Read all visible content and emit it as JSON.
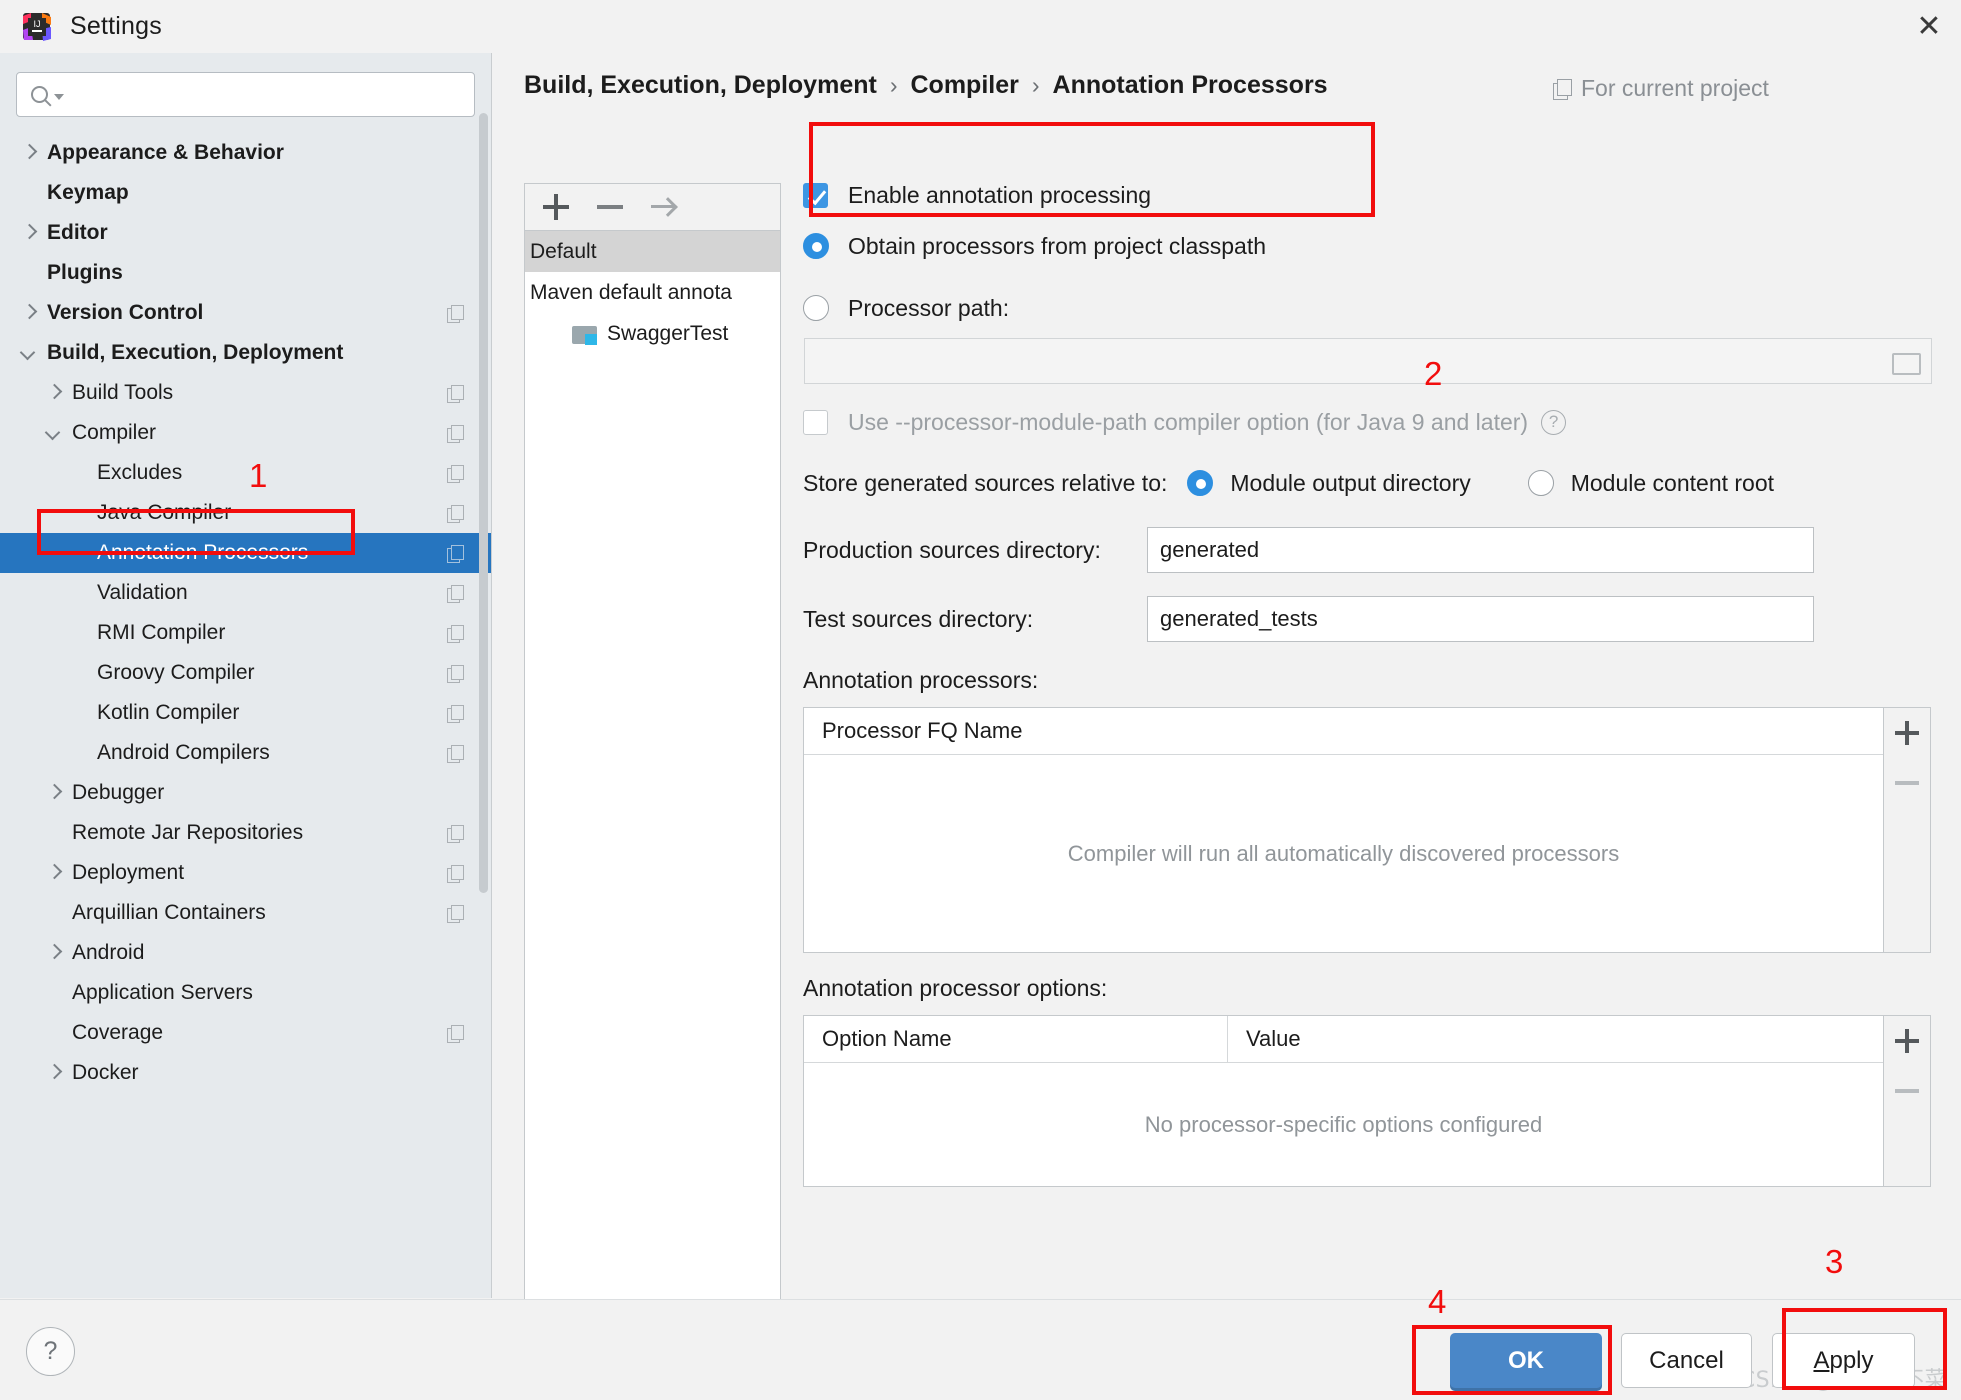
{
  "window": {
    "title": "Settings",
    "app_icon": "intellij-idea-logo",
    "close_label": "✕"
  },
  "search": {
    "value": "",
    "placeholder": ""
  },
  "sidebar": {
    "items": [
      {
        "label": "Appearance & Behavior",
        "indent": 0,
        "arrow": "right",
        "bold": true,
        "copy": false,
        "selected": false
      },
      {
        "label": "Keymap",
        "indent": 0,
        "arrow": "none",
        "bold": true,
        "copy": false,
        "selected": false
      },
      {
        "label": "Editor",
        "indent": 0,
        "arrow": "right",
        "bold": true,
        "copy": false,
        "selected": false
      },
      {
        "label": "Plugins",
        "indent": 0,
        "arrow": "none",
        "bold": true,
        "copy": false,
        "selected": false
      },
      {
        "label": "Version Control",
        "indent": 0,
        "arrow": "right",
        "bold": true,
        "copy": true,
        "selected": false
      },
      {
        "label": "Build, Execution, Deployment",
        "indent": 0,
        "arrow": "down",
        "bold": true,
        "copy": false,
        "selected": false
      },
      {
        "label": "Build Tools",
        "indent": 1,
        "arrow": "right",
        "bold": false,
        "copy": true,
        "selected": false
      },
      {
        "label": "Compiler",
        "indent": 1,
        "arrow": "down",
        "bold": false,
        "copy": true,
        "selected": false
      },
      {
        "label": "Excludes",
        "indent": 2,
        "arrow": "none",
        "bold": false,
        "copy": true,
        "selected": false
      },
      {
        "label": "Java Compiler",
        "indent": 2,
        "arrow": "none",
        "bold": false,
        "copy": true,
        "selected": false
      },
      {
        "label": "Annotation Processors",
        "indent": 2,
        "arrow": "none",
        "bold": false,
        "copy": true,
        "selected": true
      },
      {
        "label": "Validation",
        "indent": 2,
        "arrow": "none",
        "bold": false,
        "copy": true,
        "selected": false
      },
      {
        "label": "RMI Compiler",
        "indent": 2,
        "arrow": "none",
        "bold": false,
        "copy": true,
        "selected": false
      },
      {
        "label": "Groovy Compiler",
        "indent": 2,
        "arrow": "none",
        "bold": false,
        "copy": true,
        "selected": false
      },
      {
        "label": "Kotlin Compiler",
        "indent": 2,
        "arrow": "none",
        "bold": false,
        "copy": true,
        "selected": false
      },
      {
        "label": "Android Compilers",
        "indent": 2,
        "arrow": "none",
        "bold": false,
        "copy": true,
        "selected": false
      },
      {
        "label": "Debugger",
        "indent": 1,
        "arrow": "right",
        "bold": false,
        "copy": false,
        "selected": false
      },
      {
        "label": "Remote Jar Repositories",
        "indent": 1,
        "arrow": "none",
        "bold": false,
        "copy": true,
        "selected": false
      },
      {
        "label": "Deployment",
        "indent": 1,
        "arrow": "right",
        "bold": false,
        "copy": true,
        "selected": false
      },
      {
        "label": "Arquillian Containers",
        "indent": 1,
        "arrow": "none",
        "bold": false,
        "copy": true,
        "selected": false
      },
      {
        "label": "Android",
        "indent": 1,
        "arrow": "right",
        "bold": false,
        "copy": false,
        "selected": false
      },
      {
        "label": "Application Servers",
        "indent": 1,
        "arrow": "none",
        "bold": false,
        "copy": false,
        "selected": false
      },
      {
        "label": "Coverage",
        "indent": 1,
        "arrow": "none",
        "bold": false,
        "copy": true,
        "selected": false
      },
      {
        "label": "Docker",
        "indent": 1,
        "arrow": "right",
        "bold": false,
        "copy": false,
        "selected": false
      }
    ]
  },
  "breadcrumb": {
    "part1": "Build, Execution, Deployment",
    "sep1": "›",
    "part2": "Compiler",
    "sep2": "›",
    "part3": "Annotation Processors"
  },
  "scope": {
    "label": "For current project",
    "icon": "copy-icon"
  },
  "profiles": {
    "toolbar": {
      "add": "+",
      "remove": "−",
      "move": "→"
    },
    "items": [
      {
        "label": "Default",
        "selected": true,
        "type": "profile"
      },
      {
        "label": "Maven default annota",
        "selected": false,
        "type": "profile"
      },
      {
        "label": "SwaggerTest",
        "selected": false,
        "type": "module"
      }
    ]
  },
  "main": {
    "enable_annotation_processing": {
      "label": "Enable annotation processing",
      "checked": true
    },
    "obtain_from_classpath": {
      "label": "Obtain processors from project classpath",
      "selected": true
    },
    "processor_path": {
      "label": "Processor path:",
      "selected": false,
      "value": "",
      "browse_icon": "folder-icon"
    },
    "module_path_option": {
      "label": "Use --processor-module-path compiler option (for Java 9 and later)",
      "checked": false,
      "disabled": true,
      "help_icon": "question-mark-icon"
    },
    "store_sources": {
      "label": "Store generated sources relative to:",
      "option_a": "Module output directory",
      "option_b": "Module content root",
      "selected": "Module output directory"
    },
    "production_dir": {
      "label": "Production sources directory:",
      "value": "generated"
    },
    "test_dir": {
      "label": "Test sources directory:",
      "value": "generated_tests"
    },
    "processors_table": {
      "label": "Annotation processors:",
      "columns": [
        "Processor FQ Name"
      ],
      "empty_text": "Compiler will run all automatically discovered processors",
      "rows": [],
      "buttons": {
        "add": "+",
        "remove": "−"
      }
    },
    "options_table": {
      "label": "Annotation processor options:",
      "columns": [
        "Option Name",
        "Value"
      ],
      "empty_text": "No processor-specific options configured",
      "rows": [],
      "buttons": {
        "add": "+",
        "remove": "−"
      }
    }
  },
  "footer": {
    "help": "?",
    "ok": "OK",
    "cancel": "Cancel",
    "apply_underlined": "A",
    "apply_rest": "pply"
  },
  "annotations": {
    "n1": "1",
    "n2": "2",
    "n3": "3",
    "n4": "4",
    "color": "#f20d0d"
  },
  "watermark": "CSDN @我真的不菜"
}
